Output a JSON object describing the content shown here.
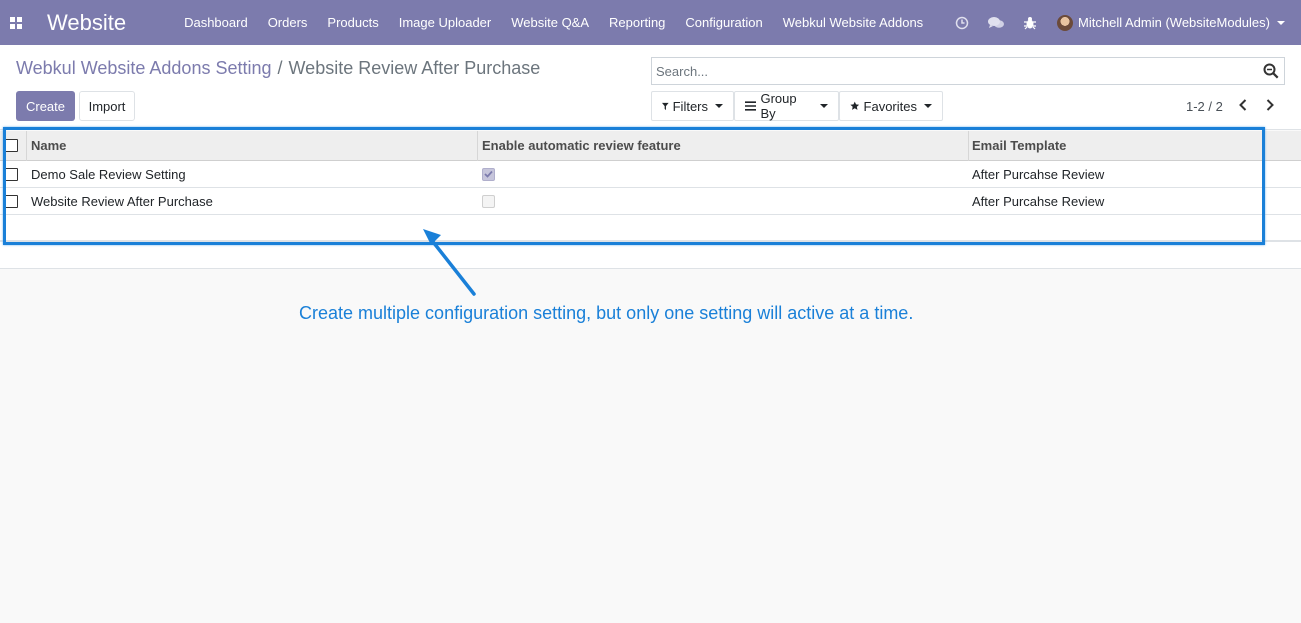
{
  "navbar": {
    "brand": "Website",
    "menu": [
      {
        "label": "Dashboard"
      },
      {
        "label": "Orders"
      },
      {
        "label": "Products"
      },
      {
        "label": "Image Uploader"
      },
      {
        "label": "Website Q&A"
      },
      {
        "label": "Reporting"
      },
      {
        "label": "Configuration"
      },
      {
        "label": "Webkul Website Addons"
      }
    ],
    "user": "Mitchell Admin (WebsiteModules)"
  },
  "breadcrumb": {
    "parent": "Webkul Website Addons Setting",
    "separator": "/",
    "current": "Website Review After Purchase"
  },
  "buttons": {
    "create": "Create",
    "import": "Import"
  },
  "search": {
    "placeholder": "Search..."
  },
  "filters": {
    "filters": "Filters",
    "group_by": "Group By",
    "favorites": "Favorites"
  },
  "pager": {
    "value": "1-2 / 2"
  },
  "table": {
    "columns": {
      "name": "Name",
      "enable": "Enable automatic review feature",
      "template": "Email Template"
    },
    "rows": [
      {
        "name": "Demo Sale Review Setting",
        "enabled": true,
        "template": "After Purcahse Review"
      },
      {
        "name": "Website Review After Purchase",
        "enabled": false,
        "template": "After Purcahse Review"
      }
    ]
  },
  "annotation": {
    "text": "Create multiple configuration setting, but only one setting will active at a time."
  },
  "colors": {
    "brand": "#7c7bad",
    "annotation": "#1a80d8"
  }
}
